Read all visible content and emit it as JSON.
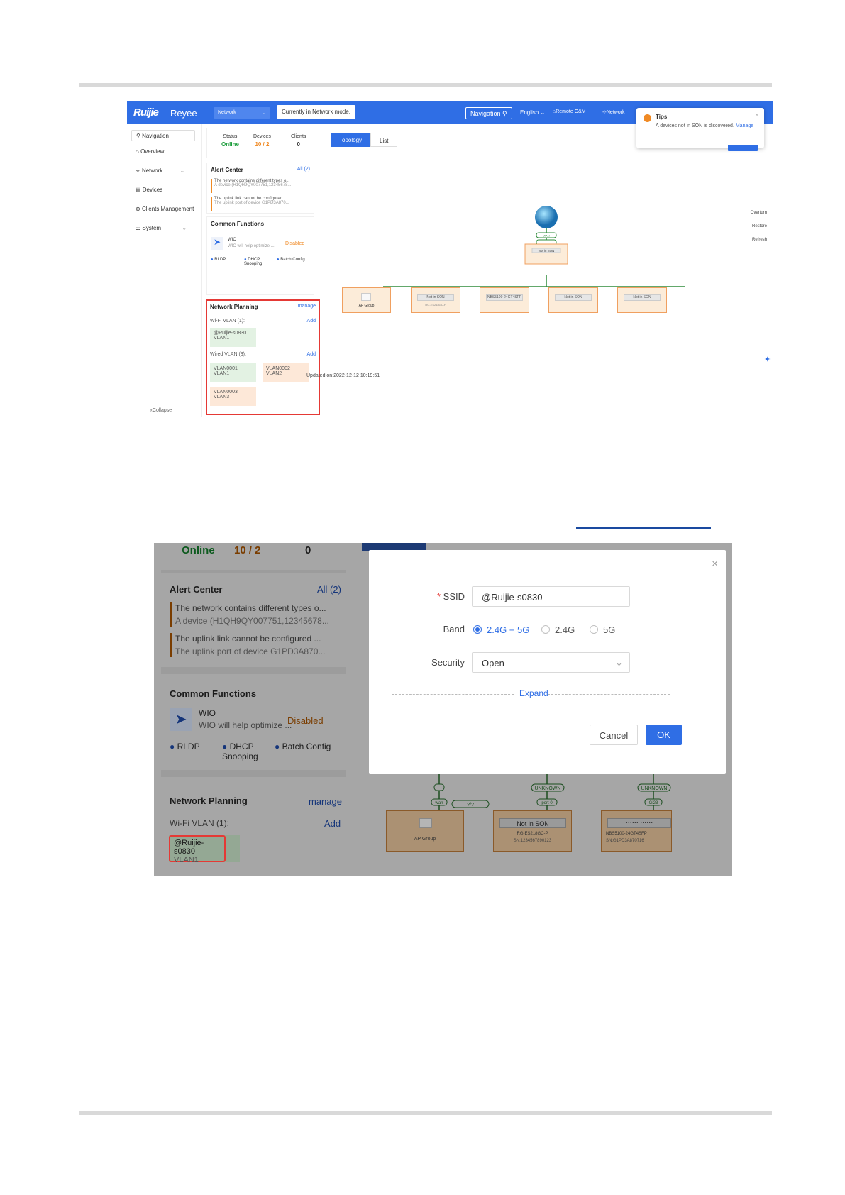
{
  "header": {
    "logo": "Ruijie",
    "brand": "Reyee",
    "network_select": "Network",
    "network_hint": "Currently in Network mode.",
    "navigation": "Navigation",
    "language": "English",
    "remote": "Remote O&M",
    "network_link": "Network"
  },
  "tips": {
    "title": "Tips",
    "message": "A devices not in SON is discovered.",
    "manage": "Manage"
  },
  "sidebar": {
    "search": "Navigation",
    "items": [
      "Overview",
      "Network",
      "Devices",
      "Clients Management",
      "System"
    ],
    "collapse": "Collapse"
  },
  "status": {
    "status_label": "Status",
    "status_value": "Online",
    "devices_label": "Devices",
    "devices_value": "10 / 2",
    "clients_label": "Clients",
    "clients_value": "0"
  },
  "alert": {
    "title": "Alert Center",
    "all": "All (2)",
    "items": [
      {
        "title": "The network contains different types o...",
        "detail": "A device (H1QH9QY007751,12345678..."
      },
      {
        "title": "The uplink link cannot be configured ...",
        "detail": "The uplink port of device G1PD3A870..."
      }
    ]
  },
  "common": {
    "title": "Common Functions",
    "wio_name": "WIO",
    "wio_desc": "WIO will help optimize ...",
    "wio_state": "Disabled",
    "funcs": [
      "RLDP",
      "DHCP Snooping",
      "Batch Config"
    ]
  },
  "planning": {
    "title": "Network Planning",
    "manage": "manage",
    "wifi_label": "Wi-Fi VLAN (1):",
    "add": "Add",
    "wifi": [
      {
        "name": "@Ruijie-s0830",
        "vlan": "VLAN1"
      }
    ],
    "wired_label": "Wired VLAN (3):",
    "wired": [
      {
        "name": "VLAN0001",
        "vlan": "VLAN1"
      },
      {
        "name": "VLAN0002",
        "vlan": "VLAN2"
      },
      {
        "name": "VLAN0003",
        "vlan": "VLAN3"
      }
    ]
  },
  "topology": {
    "tabs": [
      "Topology",
      "List"
    ],
    "actions": [
      "Overturn",
      "Restore",
      "Refresh"
    ],
    "updated": "Updated on:2022-12-12 10:19:51",
    "root_device": "Not in SON",
    "root_port": "WAN",
    "children": [
      {
        "label": "AP Group",
        "port": "wan",
        "link": "?/?"
      },
      {
        "label": "Not in SON",
        "port": "UNKNOWN",
        "port2": "port 0",
        "sn": "RG-ES218GC-P"
      },
      {
        "label": "NBS5100-24GT4SFP",
        "port": "UNKNOWN",
        "port2": "Gi23"
      },
      {
        "label": "Not in SON",
        "port": "UNKNOWN",
        "port2": "WAN"
      },
      {
        "label": "Not in SON",
        "port": "UNKNOWN",
        "port2": "Gi3"
      }
    ]
  },
  "dialog": {
    "ssid_label": "SSID",
    "ssid_value": "@Ruijie-s0830",
    "band_label": "Band",
    "bands": [
      "2.4G + 5G",
      "2.4G",
      "5G"
    ],
    "selected_band": "2.4G + 5G",
    "security_label": "Security",
    "security_value": "Open",
    "expand": "Expand",
    "cancel": "Cancel",
    "ok": "OK"
  },
  "zoom": {
    "status_value": "Online",
    "devices_value": "10 / 2",
    "clients_value": "0",
    "alert_title": "Alert Center",
    "alert_all": "All (2)",
    "alert1_title": "The network contains different types o...",
    "alert1_detail": "A device (H1QH9QY007751,12345678...",
    "alert2_title": "The uplink link cannot be configured ...",
    "alert2_detail": "The uplink port of device G1PD3A870...",
    "common_title": "Common Functions",
    "wio_name": "WIO",
    "wio_desc": "WIO will help optimize ...",
    "wio_state": "Disabled",
    "f1": "RLDP",
    "f2": "DHCP Snooping",
    "f3": "Batch Config",
    "np_title": "Network Planning",
    "np_manage": "manage",
    "wifi_label": "Wi-Fi VLAN (1):",
    "add": "Add",
    "wifi_name": "@Ruijie-s0830",
    "wifi_vlan": "VLAN1",
    "port_unknown": "UNKNOWN",
    "port_wan": "wan",
    "port0": "port 0",
    "gi23": "Gi23",
    "link": "?/?",
    "ap_group": "AP Group",
    "not_in_son": "Not in SON",
    "sn1": "RG-ES218GC-P",
    "sn1b": "SN:1234567890123",
    "sn2": "NBS5100-24GT4SFP",
    "sn2b": "SN:G1PD3A870716"
  }
}
